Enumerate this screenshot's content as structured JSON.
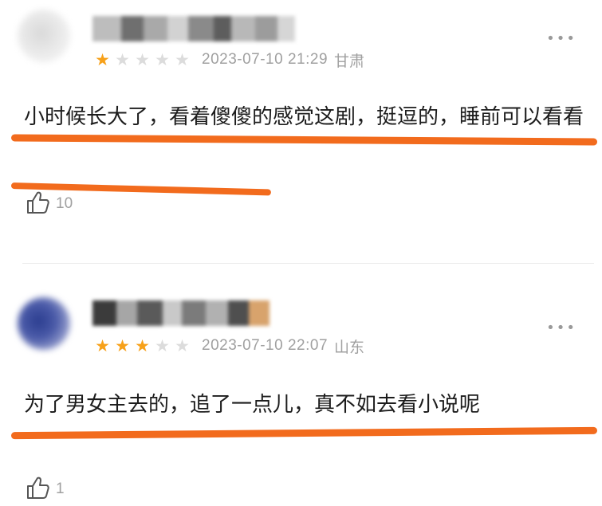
{
  "comments": [
    {
      "username": "",
      "rating": 1,
      "max_rating": 5,
      "time": "2023-07-10 21:29",
      "location": "甘肃",
      "text": "小时候长大了，看着傻傻的感觉这剧，挺逗的，睡前可以看看",
      "likes": "10"
    },
    {
      "username": "",
      "rating": 3,
      "max_rating": 5,
      "time": "2023-07-10 22:07",
      "location": "山东",
      "text": "为了男女主去的，追了一点儿，真不如去看小说呢",
      "likes": "1"
    }
  ],
  "more_glyph": "•••",
  "icons": {
    "more": "more-icon",
    "like": "thumbs-up-icon"
  },
  "colors": {
    "star_on": "#f7a11a",
    "star_off": "#dcdcdc",
    "highlight": "#f26b1d",
    "meta_text": "#a0a0a0"
  }
}
